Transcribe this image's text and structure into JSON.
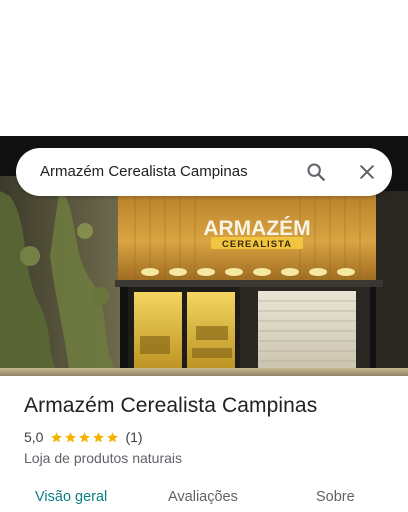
{
  "search": {
    "query": "Armazém Cerealista Campinas",
    "search_icon": "search-icon",
    "close_icon": "close-icon"
  },
  "photo": {
    "sign_line1": "ARMAZÉM",
    "sign_line2": "CEREALISTA"
  },
  "place": {
    "name": "Armazém Cerealista Campinas",
    "rating": "5,0",
    "stars": 5,
    "review_count": "(1)",
    "category": "Loja de produtos naturais"
  },
  "tabs": [
    {
      "label": "Visão geral",
      "active": true
    },
    {
      "label": "Avaliações",
      "active": false
    },
    {
      "label": "Sobre",
      "active": false
    }
  ],
  "colors": {
    "accent": "#0b7f86",
    "star": "#f4b400",
    "sign_gold": "#e8b737"
  }
}
